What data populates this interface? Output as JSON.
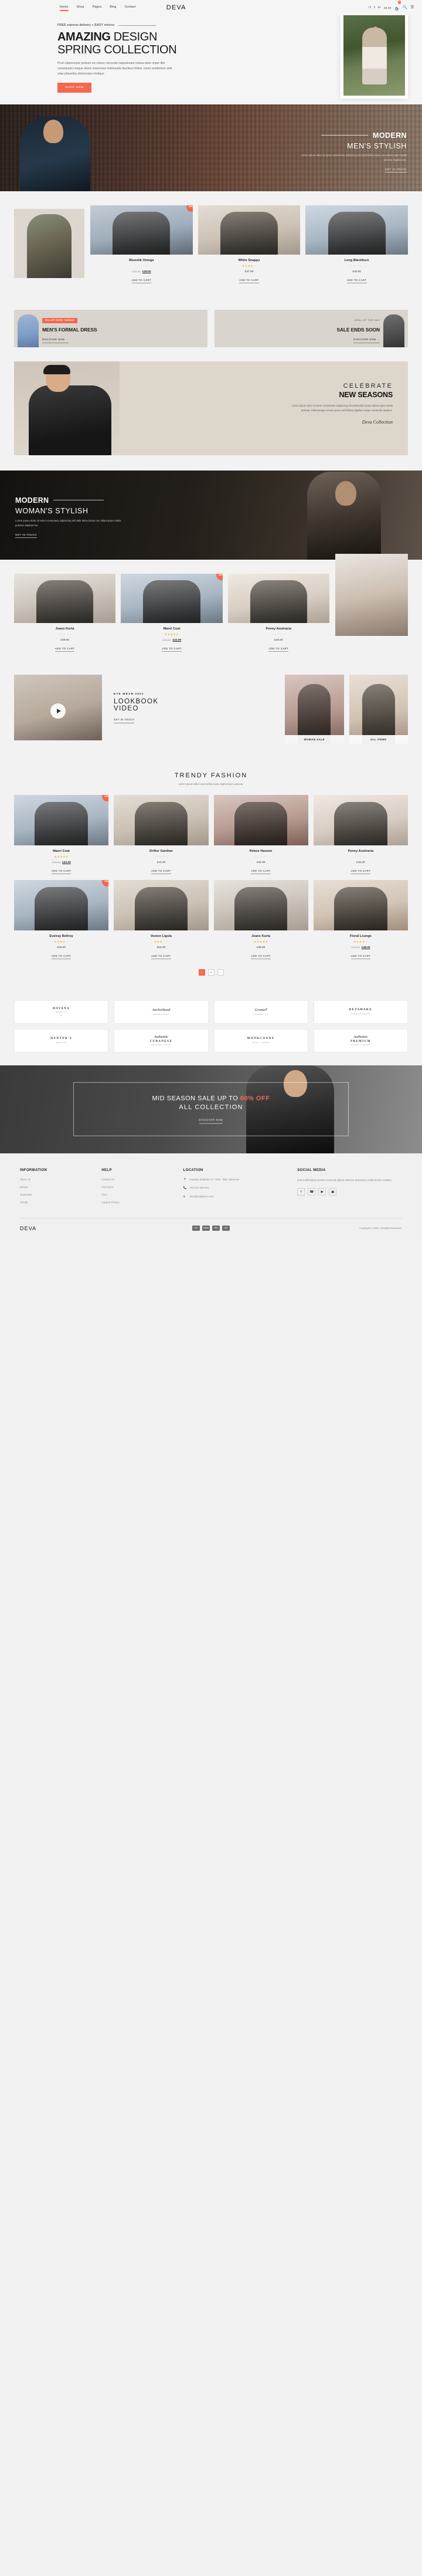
{
  "header": {
    "nav": [
      {
        "label": "Home",
        "active": true
      },
      {
        "label": "Shop",
        "active": false
      },
      {
        "label": "Pages",
        "active": false
      },
      {
        "label": "Blog",
        "active": false
      },
      {
        "label": "Contact",
        "active": false
      }
    ],
    "brand": "DEVA",
    "social": [
      "f",
      "𝕥",
      "in"
    ],
    "cart_total": "£0.00",
    "cart_count": "0",
    "search_icon": "search-icon",
    "menu_icon": "hamburger-icon"
  },
  "hero": {
    "eyebrow": "FREE express delivery + EASY returns",
    "title_bold": "AMAZING",
    "title_light": "DESIGN",
    "title_line2": "SPRING COLLECTION",
    "paragraph": "Proin ullamcorper pretium orci donec necscele risqueleoam massa dolor imper diet consequata congue idsem maecenas malesuada faucibus finibus. ictum vestibulum ante vitae phasellus ullamcorper tristique.",
    "cta": "SHOP NOW"
  },
  "men_banner": {
    "title_bold": "MODERN",
    "title_light": "MEN'S STYLISH",
    "paragraph": "Lorem ipsum dolor sit amet consectetur adipiscing elit utelit tellus luctus nec ullamcorper mattis pulvinar dapibus leo.",
    "cta": "GET IN TOUCH"
  },
  "featured": {
    "products": [
      {
        "name": "Bluestik Omega",
        "rating": 0,
        "old_price": "£35.00",
        "price": "£29.00",
        "sale": true,
        "badge": "Sale!",
        "cta": "ADD TO CART",
        "img": "ph-c"
      },
      {
        "name": "White Snappy",
        "rating": 4,
        "old_price": "",
        "price": "£37.00",
        "sale": false,
        "badge": "",
        "cta": "ADD TO CART",
        "img": "ph-d"
      },
      {
        "name": "Long Blackhure",
        "rating": 0,
        "old_price": "",
        "price": "£32.00",
        "sale": false,
        "badge": "",
        "cta": "ADD TO CART",
        "img": "ph-e"
      }
    ]
  },
  "promos": [
    {
      "tagline": "50% OFF EVERY TUESDAY",
      "tagline_style": "badge",
      "heading": "MEN'S FORMAL DRESS",
      "link": "DISCOVER NOW"
    },
    {
      "tagline": "DEAL OF THE DAY",
      "tagline_style": "plain",
      "heading": "SALE ENDS SOON",
      "link": "DISCOVER NOW"
    }
  ],
  "celebrate": {
    "line1": "CELEBRATE",
    "line2": "NEW SEASONS",
    "paragraph": "Lorem ipsum dolor sit amet consectetur adipiscing elit utelit tellus luctus ullamcorper mattis pulvinar. Pellentesque ornare purus sed finibus dapibus neque commodo dapibus.",
    "signature": "Deva Collection"
  },
  "women_banner": {
    "title_bold": "MODERN",
    "title_light": "WOMAN'S STYLISH",
    "paragraph": "Lorem ipsum dolor sit amet consectetur adipiscing elit utelit tellus luctus nec ullamcorper mattis pulvinar dapibus leo.",
    "cta": "GET IN TOUCH"
  },
  "women_products": [
    {
      "name": "Jeans Kurta",
      "rating": 0,
      "old_price": "",
      "price": "£39.00",
      "sale": false,
      "badge": "",
      "cta": "ADD TO CART",
      "img": "ph-a"
    },
    {
      "name": "Maori Coat",
      "rating": 5,
      "old_price": "£50.00",
      "price": "£42.00",
      "sale": true,
      "badge": "Sale!",
      "cta": "ADD TO CART",
      "img": "ph-e"
    },
    {
      "name": "Penny Austracia",
      "rating": 0,
      "old_price": "",
      "price": "£46.00",
      "sale": false,
      "badge": "",
      "cta": "ADD TO CART",
      "img": "ph-h"
    }
  ],
  "lookbook": {
    "eyebrow": "EYE WEAR 2021",
    "heading_line1": "LOOKBOOK",
    "heading_line2": "VIDEO",
    "link": "GET IN TOUCH",
    "play_icon": "play-icon",
    "cards": [
      {
        "label": "WOMAN SALE",
        "img": "ph-g"
      },
      {
        "label": "ALL ITEMS",
        "img": "ph-f"
      }
    ]
  },
  "trendy": {
    "heading": "TRENDY FASHION",
    "subheading": "Lorem ipsum dolor amet tellus luctus ullamcorper pulvinar.",
    "products": [
      {
        "name": "Maori Coat",
        "rating": 5,
        "old_price": "£50.00",
        "price": "£42.00",
        "sale": true,
        "badge": "Sale!",
        "cta": "ADD TO CART",
        "img": "ph-e"
      },
      {
        "name": "Drifter Gardian",
        "rating": 0,
        "old_price": "",
        "price": "£44.00",
        "sale": false,
        "badge": "",
        "cta": "ADD TO CART",
        "img": "ph-d"
      },
      {
        "name": "Rebox Hansen",
        "rating": 0,
        "old_price": "",
        "price": "£34.00",
        "sale": false,
        "badge": "",
        "cta": "ADD TO CART",
        "img": "ph-g"
      },
      {
        "name": "Penny Austracia",
        "rating": 0,
        "old_price": "",
        "price": "£46.00",
        "sale": false,
        "badge": "",
        "cta": "ADD TO CART",
        "img": "ph-h"
      },
      {
        "name": "Evelray Bellroy",
        "rating": 4,
        "old_price": "",
        "price": "£29.00",
        "sale": true,
        "badge": "Sale!",
        "cta": "ADD TO CART",
        "img": "ph-e"
      },
      {
        "name": "Veston Ligula",
        "rating": 3,
        "old_price": "",
        "price": "£52.00",
        "sale": false,
        "badge": "",
        "cta": "ADD TO CART",
        "img": "ph-d"
      },
      {
        "name": "Jeans Kurta",
        "rating": 5,
        "old_price": "",
        "price": "£39.00",
        "sale": false,
        "badge": "",
        "cta": "ADD TO CART",
        "img": "ph-a"
      },
      {
        "name": "Floral Lounge",
        "rating": 4,
        "old_price": "£55.00",
        "price": "£48.00",
        "sale": false,
        "badge": "",
        "cta": "ADD TO CART",
        "img": "ph-f"
      }
    ],
    "pages": [
      {
        "label": "1",
        "active": true
      },
      {
        "label": "2",
        "active": false
      },
      {
        "label": "→",
        "active": false
      }
    ]
  },
  "brands": [
    {
      "title": "HAVANA",
      "sub": "WEAR CO",
      "script": "",
      "num": "02"
    },
    {
      "title": "",
      "sub": "ESTABLISHED",
      "script": "Anchorhead",
      "num": ""
    },
    {
      "title": "",
      "sub": "APPAREL CO",
      "script": "Gromell",
      "num": ""
    },
    {
      "title": "BETAWAKE",
      "sub": "PREMIUM BRAND",
      "script": "",
      "num": ""
    },
    {
      "title": "HUNTER'S",
      "sub": "WEAR CO",
      "script": "",
      "num": ""
    },
    {
      "title": "CUBANESE",
      "sub": "ORIGINAL SINCE",
      "script": "Authentic",
      "num": ""
    },
    {
      "title": "MONKCOONE",
      "sub": "BAGS • SHOES",
      "script": "",
      "num": ""
    },
    {
      "title": "PREMIUM",
      "sub": "QUALITY GOODS",
      "script": "Authentic",
      "num": ""
    }
  ],
  "midseason": {
    "line1_a": "MID SEASON SALE UP TO",
    "line1_b": "60% OFF",
    "line2": "ALL COLLECTION",
    "link": "DISCOVER NOW"
  },
  "footer": {
    "columns": [
      {
        "heading": "INFORMATION",
        "links": [
          "About Us",
          "Deliver",
          "Guarantee",
          "Trends"
        ]
      },
      {
        "heading": "HELP",
        "links": [
          "Contact Us",
          "Find Store",
          "Term",
          "Legal & Privacy"
        ]
      }
    ],
    "location": {
      "heading": "LOCATION",
      "address": "Uluwatu Jimbaran ST. 1919 - Bali, Indonesia",
      "phone": "+62 212-345-321",
      "email": "deva@mailstore.com"
    },
    "social": {
      "heading": "SOCIAL MEDIA",
      "description": "Duis mollis ligula pretium conseuat aliquet ullamcor permassa condimentum sodales.",
      "icons": [
        "facebook-icon",
        "whatsapp-icon",
        "youtube-icon",
        "instagram-icon"
      ]
    },
    "brand": "DEVA",
    "payments": [
      "MC",
      "PayPal",
      "VISA",
      "JCB"
    ],
    "copyright": "Copyright © 2020. All Rights Reserved."
  },
  "colors": {
    "accent": "#f4674f",
    "dark": "#1a1a1a",
    "bg": "#f2f2f2",
    "star": "#f0b429"
  }
}
